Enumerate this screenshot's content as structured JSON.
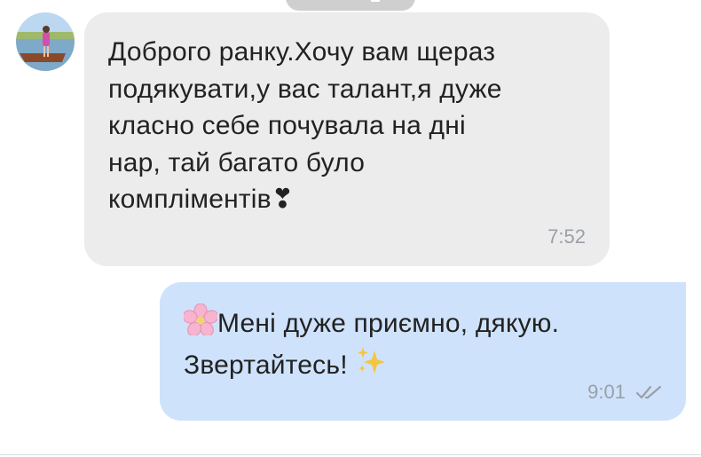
{
  "chat": {
    "incoming": {
      "text": "Доброго ранку.Хочу вам щераз\nподякувати,у вас талант,я дуже\nкласно себе почувала на дні\nнар, тай багато було\nкомпліментів",
      "heart_glyph": "❣",
      "time": "7:52"
    },
    "outgoing": {
      "text_line1": "Мені дуже приємно, дякую.",
      "text_line2": "Звертайтесь!",
      "time": "9:01",
      "status_icon": "double-check-icon"
    }
  },
  "colors": {
    "incoming_bubble": "#ececec",
    "outgoing_bubble": "#cfe2fb",
    "text": "#222222",
    "time": "#9aa0a8",
    "date_pill": "#cfcfcf"
  }
}
